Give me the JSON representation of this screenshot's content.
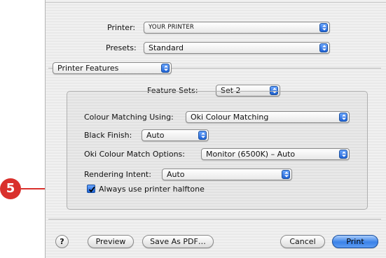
{
  "printer": {
    "label": "Printer:",
    "value": "YOUR PRINTER"
  },
  "presets": {
    "label": "Presets:",
    "value": "Standard"
  },
  "section": {
    "value": "Printer Features"
  },
  "feature_sets": {
    "label": "Feature Sets:",
    "value": "Set 2"
  },
  "options": {
    "colour_matching": {
      "label": "Colour Matching Using:",
      "value": "Oki Colour Matching"
    },
    "black_finish": {
      "label": "Black Finish:",
      "value": "Auto"
    },
    "oki_colour_match": {
      "label": "Oki Colour Match Options:",
      "value": "Monitor (6500K) – Auto"
    },
    "rendering_intent": {
      "label": "Rendering Intent:",
      "value": "Auto"
    },
    "halftone": {
      "label": "Always use printer halftone",
      "checked": true
    }
  },
  "buttons": {
    "help": "?",
    "preview": "Preview",
    "save_pdf": "Save As PDF…",
    "cancel": "Cancel",
    "print": "Print"
  },
  "callout": {
    "number": "5",
    "color": "#d9302c"
  },
  "colors": {
    "accent": "#1f62d4"
  }
}
